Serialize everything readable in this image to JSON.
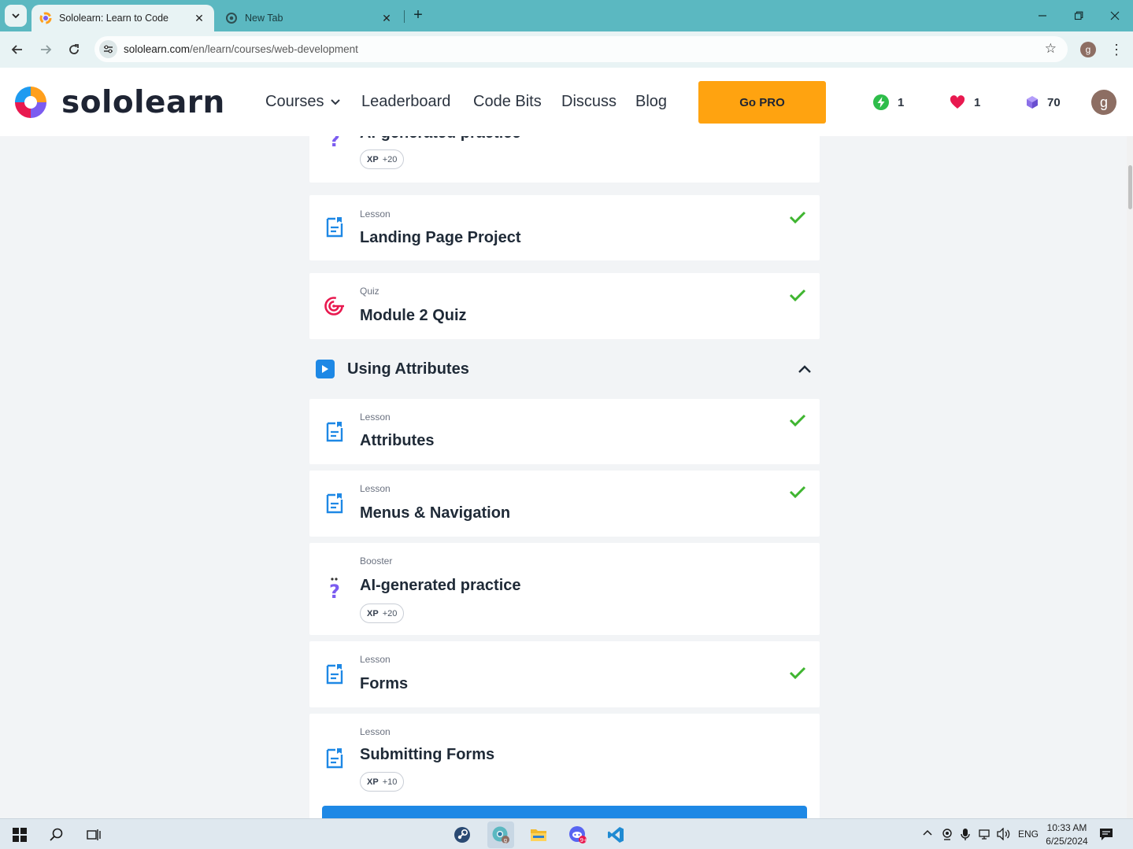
{
  "browser": {
    "tabs": [
      {
        "title": "Sololearn: Learn to Code",
        "active": true
      },
      {
        "title": "New Tab",
        "active": false
      }
    ],
    "url_host": "sololearn.com",
    "url_path": "/en/learn/courses/web-development",
    "profile_initial": "g"
  },
  "header": {
    "brand": "sololearn",
    "nav": {
      "courses": "Courses",
      "leaderboard": "Leaderboard",
      "code_bits": "Code Bits",
      "discuss": "Discuss",
      "blog": "Blog"
    },
    "go_pro": "Go PRO",
    "streak": "1",
    "hearts": "1",
    "gems": "70",
    "avatar_initial": "g",
    "colors": {
      "accent": "#ffa310",
      "streak": "#2ebd4a",
      "heart": "#e8194f",
      "gem": "#8b6fe8"
    }
  },
  "content": {
    "top_card": {
      "title": "AI-generated practice",
      "xp_label": "XP",
      "xp_value": "+20"
    },
    "cards_before": [
      {
        "kind": "Lesson",
        "title": "Landing Page Project",
        "icon": "lesson-icon",
        "completed": true
      },
      {
        "kind": "Quiz",
        "title": "Module 2 Quiz",
        "icon": "quiz-target-icon",
        "completed": true
      }
    ],
    "section": {
      "title": "Using Attributes",
      "expanded": true
    },
    "cards": [
      {
        "kind": "Lesson",
        "title": "Attributes",
        "icon": "lesson-icon",
        "completed": true
      },
      {
        "kind": "Lesson",
        "title": "Menus & Navigation",
        "icon": "lesson-icon",
        "completed": true
      },
      {
        "kind": "Booster",
        "title": "AI-generated practice",
        "icon": "booster-question-icon",
        "completed": false,
        "xp_label": "XP",
        "xp_value": "+20"
      },
      {
        "kind": "Lesson",
        "title": "Forms",
        "icon": "lesson-icon",
        "completed": true
      },
      {
        "kind": "Lesson",
        "title": "Submitting Forms",
        "icon": "lesson-icon",
        "completed": false,
        "xp_label": "XP",
        "xp_value": "+10"
      }
    ]
  },
  "taskbar": {
    "language": "ENG",
    "time": "10:33 AM",
    "date": "6/25/2024"
  }
}
